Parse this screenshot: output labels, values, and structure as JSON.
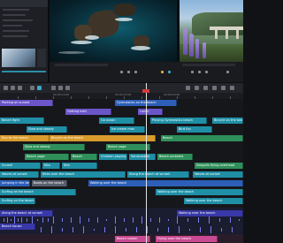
{
  "colors": {
    "teal": "#1f8fa6",
    "green": "#2f8f5a",
    "blue": "#2d5fb8",
    "orange": "#d89b2c",
    "purple": "#6b55c9",
    "pink": "#c94a92",
    "audio": "#3838a8"
  },
  "ruler": {
    "t1": "00:00:10:00",
    "t2": "00:00:15:00",
    "t3": "00:00:20:00"
  },
  "clips": {
    "c1": "Parking on sunset",
    "c2": "Gymnastics on the beach",
    "c3": "Getting hold",
    "c4": "Lunch",
    "c5": "Beach fight",
    "c6": "Go ocean",
    "c7": "Playing Gymnastics beach",
    "c8": "Ice cream man",
    "c9": "Bird fun",
    "c10": "Bicycle on the beach",
    "c11": "Slow and steady",
    "c12": "Run to the beach",
    "c13": "Beach yoga",
    "c14": "Beach",
    "c15": "Children playing",
    "c16": "Sandcastles",
    "c17": "Beach umbrella",
    "c18": "Seagulls flying overhead",
    "c19": "Sunset",
    "c20": "Kite",
    "c21": "Kites over the beach",
    "c22": "Along the beach at sunset",
    "c23": "Waves at sunset",
    "c24": "Jumping in the beach",
    "c25": "Boats on the beach",
    "c26": "Walking over the beach",
    "c27": "Surfing at the beach",
    "c28": "Walking over the beach",
    "c29": "Surfing on the beach",
    "c30": "Along the beach at sunset",
    "c31": "Walking near the beach",
    "c32": "Beach house",
    "c33": "Beach slalom",
    "c34": "Flying over the beach"
  }
}
